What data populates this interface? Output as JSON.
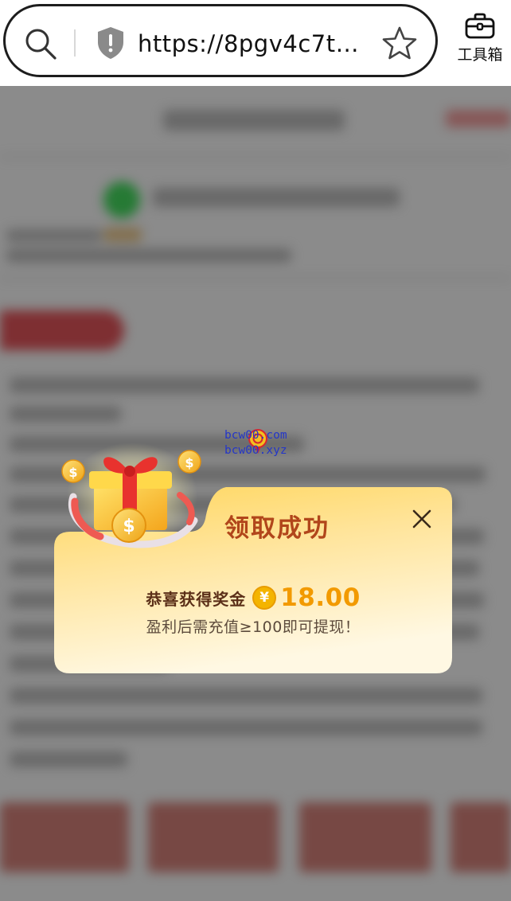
{
  "browser": {
    "url": "https://8pgv4c7t9r…",
    "toolbox_label": "工具箱"
  },
  "watermark": {
    "line1": "bcw00.com",
    "line2": "bcw00.xyz"
  },
  "dialog": {
    "title": "领取成功",
    "congrats_label": "恭喜获得奖金",
    "currency_symbol": "¥",
    "amount": "18.00",
    "note": "盈利后需充值≥100即可提现！"
  },
  "colors": {
    "title": "#b1461b",
    "amount": "#f29a00",
    "coin": "#f4b400",
    "dialog_top": "#ffd65c",
    "dialog_bottom": "#fff8e3"
  }
}
